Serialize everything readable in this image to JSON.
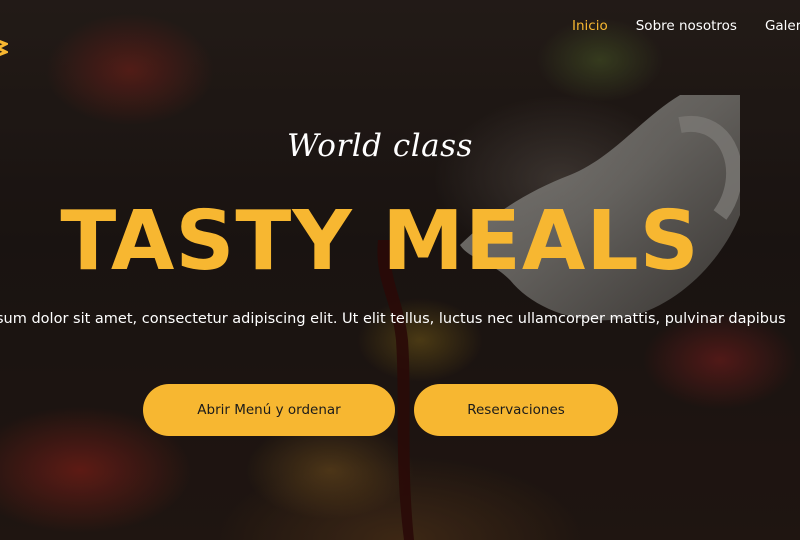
{
  "colors": {
    "accent": "#f7b731",
    "text": "#ffffff",
    "button_text": "#1b1b1b"
  },
  "nav": {
    "items": [
      {
        "label": "Inicio",
        "active": true
      },
      {
        "label": "Sobre nosotros",
        "active": false
      },
      {
        "label": "Galería",
        "active": false
      }
    ]
  },
  "hero": {
    "tagline": "World class",
    "headline": "TASTY MEALS",
    "subtitle": "sum dolor sit amet, consectetur adipiscing elit. Ut elit tellus, luctus nec ullamcorper mattis, pulvinar dapibus"
  },
  "buttons": {
    "menu_label": "Abrir Menú y ordenar",
    "reservations_label": "Reservaciones"
  },
  "icons": {
    "logo": "logo-icon"
  }
}
